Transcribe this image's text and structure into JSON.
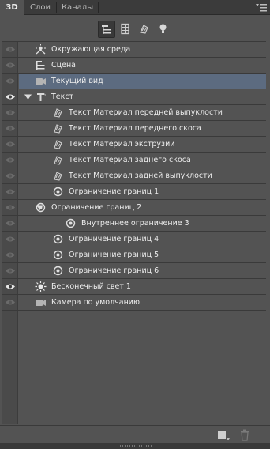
{
  "tabs": [
    {
      "label": "3D",
      "active": true
    },
    {
      "label": "Слои",
      "active": false
    },
    {
      "label": "Каналы",
      "active": false
    }
  ],
  "toolbar": {
    "filters": [
      {
        "icon": "scene-filter-icon",
        "active": true
      },
      {
        "icon": "mesh-filter-icon",
        "active": false
      },
      {
        "icon": "materials-filter-icon",
        "active": false
      },
      {
        "icon": "lights-filter-icon",
        "active": false
      }
    ]
  },
  "colors": {
    "panel_bg": "#535353",
    "tab_bg": "#3b3b3b",
    "selected_row": "#5c6b80",
    "text": "#ececec"
  },
  "scene": {
    "rows": [
      {
        "label": "Окружающая среда",
        "icon": "environment-icon",
        "eye": false,
        "depth": 0,
        "twisty": "none",
        "selected": false
      },
      {
        "label": "Сцена",
        "icon": "scene-icon",
        "eye": false,
        "depth": 0,
        "twisty": "none",
        "selected": false
      },
      {
        "label": "Текущий вид",
        "icon": "camera-icon",
        "eye": false,
        "depth": 1,
        "twisty": "none",
        "selected": true
      },
      {
        "label": "Текст",
        "icon": "text-mesh-icon",
        "eye": true,
        "depth": 0,
        "twisty": "open",
        "selected": false
      },
      {
        "label": "Текст Материал передней выпуклости",
        "icon": "material-icon",
        "eye": false,
        "depth": 2,
        "twisty": "none",
        "selected": false
      },
      {
        "label": "Текст Материал переднего скоса",
        "icon": "material-icon",
        "eye": false,
        "depth": 2,
        "twisty": "none",
        "selected": false
      },
      {
        "label": "Текст Материал экструзии",
        "icon": "material-icon",
        "eye": false,
        "depth": 2,
        "twisty": "none",
        "selected": false
      },
      {
        "label": "Текст Материал заднего скоса",
        "icon": "material-icon",
        "eye": false,
        "depth": 2,
        "twisty": "none",
        "selected": false
      },
      {
        "label": "Текст Материал задней выпуклости",
        "icon": "material-icon",
        "eye": false,
        "depth": 2,
        "twisty": "none",
        "selected": false
      },
      {
        "label": "Ограничение границ 1",
        "icon": "constraint-icon",
        "eye": false,
        "depth": 2,
        "twisty": "none",
        "selected": false
      },
      {
        "label": "Ограничение границ 2",
        "icon": "constraint-icon",
        "eye": false,
        "depth": 1,
        "twisty": "open",
        "selected": false
      },
      {
        "label": "Внутреннее ограничение 3",
        "icon": "constraint-icon",
        "eye": false,
        "depth": 3,
        "twisty": "none",
        "selected": false
      },
      {
        "label": "Ограничение границ 4",
        "icon": "constraint-icon",
        "eye": false,
        "depth": 2,
        "twisty": "none",
        "selected": false
      },
      {
        "label": "Ограничение границ 5",
        "icon": "constraint-icon",
        "eye": false,
        "depth": 2,
        "twisty": "none",
        "selected": false
      },
      {
        "label": "Ограничение границ 6",
        "icon": "constraint-icon",
        "eye": false,
        "depth": 2,
        "twisty": "none",
        "selected": false
      },
      {
        "label": "Бесконечный свет 1",
        "icon": "infinite-light-icon",
        "eye": true,
        "depth": 0,
        "twisty": "none",
        "selected": false
      },
      {
        "label": "Камера по умолчанию",
        "icon": "camera-icon",
        "eye": false,
        "depth": 0,
        "twisty": "none",
        "selected": false
      }
    ]
  },
  "bottom": {
    "buttons": [
      {
        "icon": "new-object-icon"
      },
      {
        "icon": "trash-icon"
      }
    ]
  }
}
